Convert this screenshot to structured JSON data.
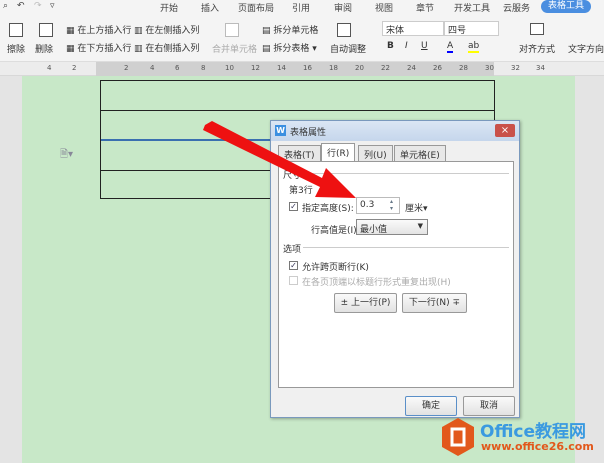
{
  "menubar": {
    "tabs": [
      "开始",
      "插入",
      "页面布局",
      "引用",
      "审阅",
      "视图",
      "章节",
      "开发工具",
      "云服务",
      "表格工具"
    ],
    "active": "表格工具"
  },
  "toolbar": {
    "erase": "擦除",
    "delete": "删除",
    "insert_above": "在上方插入行",
    "insert_below": "在下方插入行",
    "insert_left": "在左侧插入列",
    "insert_right": "在右侧插入列",
    "merge": "合并单元格",
    "split_cell": "拆分单元格",
    "split_table": "拆分表格",
    "auto_fit": "自动调整",
    "font": "宋体",
    "font_size": "四号",
    "bold": "B",
    "italic": "I",
    "underline": "U",
    "font_color": "A",
    "highlight": "ab",
    "align": "对齐方式",
    "text_dir": "文字方向"
  },
  "ruler": {
    "marks": [
      "4",
      "2",
      "2",
      "4",
      "6",
      "8",
      "10",
      "12",
      "14",
      "16",
      "18",
      "20",
      "22",
      "24",
      "26",
      "28",
      "30",
      "32",
      "34"
    ]
  },
  "dialog": {
    "title": "表格属性",
    "close": "×",
    "tabs": [
      "表格(T)",
      "行(R)",
      "列(U)",
      "单元格(E)"
    ],
    "active_tab": "行(R)",
    "size_section": "尺寸",
    "row_label": "第3行",
    "specify_height_label": "指定高度(S):",
    "specify_height_checked": true,
    "height_value": "0.3",
    "unit": "厘米",
    "row_height_is_label": "行高值是(I):",
    "row_height_is_value": "最小值",
    "options_section": "选项",
    "allow_break_label": "允许跨页断行(K)",
    "allow_break_checked": true,
    "repeat_header_label": "在各页顶端以标题行形式重复出现(H)",
    "repeat_header_checked": false,
    "prev_row": "上一行(P)",
    "next_row": "下一行(N)",
    "ok": "确定",
    "cancel": "取消"
  },
  "watermark": {
    "brand": "Office教程网",
    "url": "www.office26.com"
  }
}
